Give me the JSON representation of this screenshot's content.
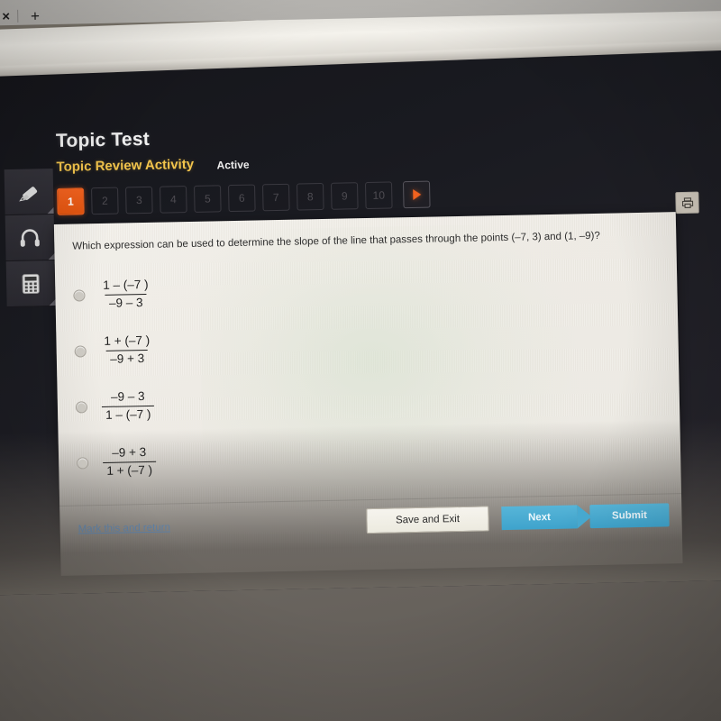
{
  "browser": {
    "close_tab": "×",
    "new_tab": "+"
  },
  "header": {
    "title": "Topic Test",
    "subtitle": "Topic Review Activity",
    "status": "Active"
  },
  "pager": {
    "items": [
      "1",
      "2",
      "3",
      "4",
      "5",
      "6",
      "7",
      "8",
      "9",
      "10"
    ],
    "active_index": 0,
    "next_icon": "play-triangle"
  },
  "toolrail": {
    "items": [
      {
        "name": "highlighter-icon",
        "label": "Highlighter"
      },
      {
        "name": "headphones-icon",
        "label": "Read aloud"
      },
      {
        "name": "calculator-icon",
        "label": "Calculator"
      }
    ]
  },
  "toolbar": {
    "print_icon": "print-icon"
  },
  "question": {
    "text": "Which expression can be used to determine the slope of the line that passes through the points (–7, 3) and (1, –9)?",
    "choices": [
      {
        "numerator": "1 – (–7 )",
        "denominator": "–9 – 3",
        "selected": false
      },
      {
        "numerator": "1 + (–7 )",
        "denominator": "–9 + 3",
        "selected": false
      },
      {
        "numerator": "–9 – 3",
        "denominator": "1 – (–7 )",
        "selected": false
      },
      {
        "numerator": "–9 + 3",
        "denominator": "1 + (–7 )",
        "selected": false
      }
    ]
  },
  "footer": {
    "mark_link": "Mark this and return",
    "save_label": "Save and Exit",
    "next_label": "Next",
    "submit_label": "Submit"
  },
  "colors": {
    "accent_orange": "#f2621f",
    "accent_yellow": "#f2c44c",
    "button_blue": "#3ea3cc",
    "link_blue": "#5d7fa4",
    "card_bg": "#efece5",
    "screen_bg": "#1a1a20"
  }
}
